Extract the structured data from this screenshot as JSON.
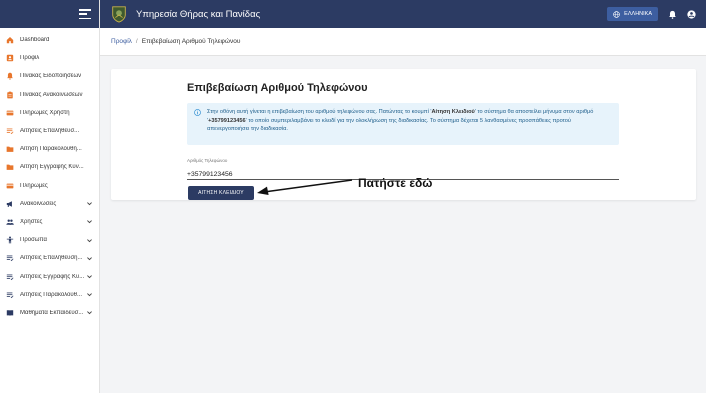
{
  "app": {
    "title": "Υπηρεσία Θήρας και Πανίδας",
    "language_button": "ΕΛΛΗΝΙΚΑ"
  },
  "sidebar": {
    "items": [
      {
        "label": "Dashboard",
        "icon": "home-icon",
        "color": "#e8762c",
        "has_chevron": false
      },
      {
        "label": "Προφίλ",
        "icon": "profile-icon",
        "color": "#e8762c",
        "has_chevron": false
      },
      {
        "label": "Πίνακας Ειδοποιήσεων",
        "icon": "bell-icon",
        "color": "#e8762c",
        "has_chevron": false
      },
      {
        "label": "Πίνακας Ανακοινώσεων",
        "icon": "clipboard-icon",
        "color": "#e8762c",
        "has_chevron": false
      },
      {
        "label": "Πληρωμές Χρήστη",
        "icon": "card-icon",
        "color": "#e8762c",
        "has_chevron": false
      },
      {
        "label": "Αιτήσεις Επαλήθευσ...",
        "icon": "list-icon",
        "color": "#e8762c",
        "has_chevron": false
      },
      {
        "label": "Αίτηση Παρακολούθη...",
        "icon": "folder-icon",
        "color": "#e8762c",
        "has_chevron": false
      },
      {
        "label": "Αίτηση Εγγραφής Κυν...",
        "icon": "folder-icon",
        "color": "#e8762c",
        "has_chevron": false
      },
      {
        "label": "Πληρωμές",
        "icon": "card-icon",
        "color": "#e8762c",
        "has_chevron": false
      },
      {
        "label": "Ανακοινώσεις",
        "icon": "megaphone-icon",
        "color": "#2c3b63",
        "has_chevron": true
      },
      {
        "label": "Χρήστες",
        "icon": "users-icon",
        "color": "#2c3b63",
        "has_chevron": true
      },
      {
        "label": "Πρόσωπα",
        "icon": "person-icon",
        "color": "#2c3b63",
        "has_chevron": true
      },
      {
        "label": "Αιτήσεις Επαλήθευση...",
        "icon": "list-icon",
        "color": "#2c3b63",
        "has_chevron": true
      },
      {
        "label": "Αιτήσεις Εγγραφής Κυ...",
        "icon": "list-icon",
        "color": "#2c3b63",
        "has_chevron": true
      },
      {
        "label": "Αιτήσεις Παρακολούθ...",
        "icon": "list-icon",
        "color": "#2c3b63",
        "has_chevron": true
      },
      {
        "label": "Μαθήματα Εκπαίδευσ...",
        "icon": "book-icon",
        "color": "#2c3b63",
        "has_chevron": true
      }
    ]
  },
  "breadcrumb": {
    "parent": "Προφίλ",
    "separator": "/",
    "current": "Επιβεβαίωση Αριθμού Τηλεφώνου"
  },
  "main": {
    "title": "Επιβεβαίωση Αριθμού Τηλεφώνου",
    "info": {
      "part1": "Στην οθόνη αυτή γίνεται η επιβεβαίωση του αριθμού τηλεφώνου σας. Πατώντας το κουμπί '",
      "bold1": "Αίτηση Κλειδιού",
      "part2": "' το σύστημα θα αποστείλει μήνυμα στον αριθμό '",
      "bold2": "+35799123456",
      "part3": "' το οποίο συμπεριλαμβάνει το κλειδί για την ολοκλήρωση της διαδικασίας. Το σύστημα δέχεται 5 λανθασμένες προσπάθειες προτού απενεργοποιήσει την διαδικασία."
    },
    "phone_field": {
      "label": "Αριθμός Τηλεφώνου",
      "value": "+35799123456"
    },
    "submit_button": "ΑΙΤΗΣΗ ΚΛΕΙΔΙΟΥ"
  },
  "annotation": {
    "text": "Πατήστε εδώ"
  },
  "colors": {
    "primary": "#2c3b63",
    "accent": "#e8762c",
    "info_bg": "#e7f3fb",
    "info_text": "#1d5d8a",
    "lang_btn": "#3d5ea0"
  }
}
